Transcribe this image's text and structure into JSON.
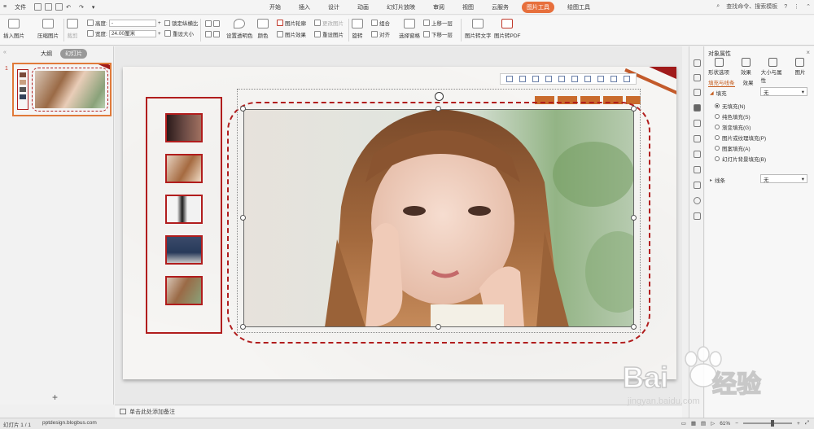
{
  "menubar": {
    "file": "文件",
    "tabs": [
      "开始",
      "插入",
      "设计",
      "动画",
      "幻灯片放映",
      "审阅",
      "视图",
      "云服务",
      "图片工具",
      "绘图工具"
    ],
    "active_tab": "图片工具",
    "search": "查找命令、搜索模板"
  },
  "ribbon": {
    "insert_picture": "插入图片",
    "compress_picture": "压缩图片",
    "crop": "裁剪",
    "height_label": "高度:",
    "width_label": "宽度:",
    "height_value": "-",
    "width_value": "24.00厘米",
    "lock_ratio": "锁定纵横比",
    "reset_size": "重设大小",
    "set_transparent": "设置透明色",
    "color": "颜色",
    "picture_outline": "图片轮廓",
    "picture_effects": "图片效果",
    "change_picture": "更改图片",
    "reset_picture": "重设图片",
    "rotate": "旋转",
    "group": "组合",
    "align": "对齐",
    "selection_pane": "选择窗格",
    "bring_forward": "上移一层",
    "send_backward": "下移一层",
    "picture_to_text": "图片转文字",
    "picture_to_pdf": "图片转PDF"
  },
  "leftpanel": {
    "tab_outline": "大纲",
    "tab_slides": "幻灯片",
    "slide_number": "1"
  },
  "notes": {
    "placeholder": "单击此处添加备注"
  },
  "props": {
    "title": "对象属性",
    "tabs": [
      "形状选项",
      "效果",
      "大小与属性",
      "图片"
    ],
    "subtab_fill_line": "填充与线条",
    "subtab_effect": "效果",
    "fill_section": "填充",
    "fill_value": "无",
    "fill_options": [
      "无填充(N)",
      "纯色填充(S)",
      "渐变填充(G)",
      "图片或纹理填充(P)",
      "图案填充(A)",
      "幻灯片背景填充(B)"
    ],
    "fill_selected": "无填充(N)",
    "line_section": "线条",
    "line_value": "无"
  },
  "status": {
    "slide_info": "幻灯片 1 / 1",
    "theme": "pptdesign.blogbus.com",
    "zoom": "61%"
  },
  "watermark": {
    "brand": "Bai",
    "brand2": "经验",
    "url": "jingyan.baidu.com"
  },
  "colors": {
    "accent_tab": "#e76f3c",
    "frame_red": "#b11d1d",
    "selection_orange": "#e07a3a"
  }
}
